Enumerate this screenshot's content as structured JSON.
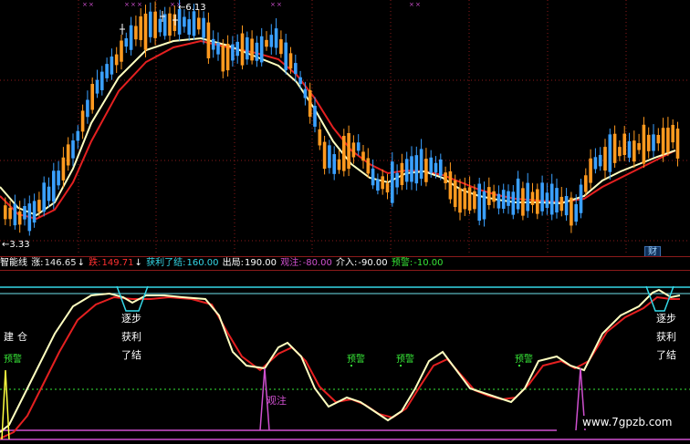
{
  "upper": {
    "high_price": "6.13",
    "low_price": "3.33",
    "finance_badge": "财",
    "colors": {
      "bull": "#ff9a1f",
      "bear": "#3aa0ff",
      "ma_fast": "#ffffc0",
      "ma_slow": "#e52020"
    }
  },
  "legend": {
    "title": "智能线",
    "up_label": "涨:",
    "up_value": "146.65",
    "up_arrow": "↓",
    "down_label": "跌:",
    "down_value": "149.71",
    "down_arrow": "↓",
    "profit_label": "获利了结:",
    "profit_value": "160.00",
    "exit_label": "出局:",
    "exit_value": "190.00",
    "watch_label": "观注:",
    "watch_value": "-80.00",
    "enter_label": "介入:",
    "enter_value": "-90.00",
    "warn_label": "预警:",
    "warn_value": "-10.00"
  },
  "signals": {
    "build": "建仓",
    "warn": "预警",
    "step": "逐步",
    "profit": "获利",
    "settle": "了结",
    "watch": "观注"
  },
  "watermark": "www.7gpzb.com"
}
